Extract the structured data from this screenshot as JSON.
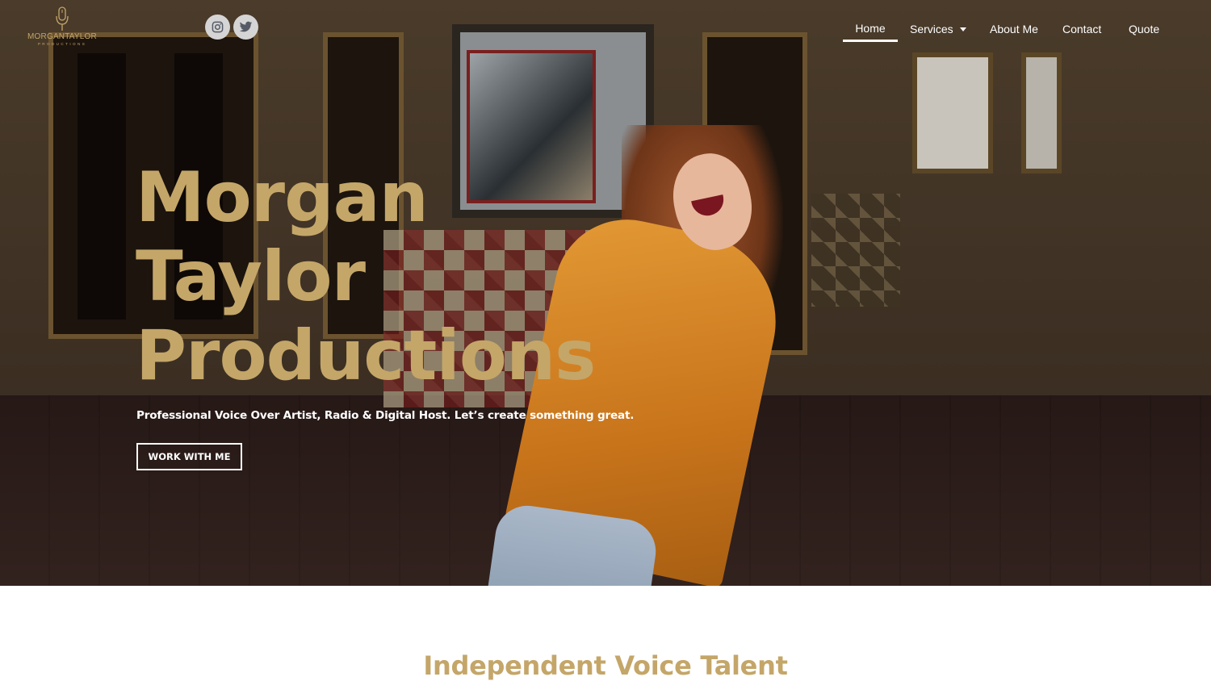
{
  "brand": {
    "logo_name": "MORGANTAYLOR",
    "logo_sub": "PRODUCTIONS",
    "logo_icon": "microphone-icon",
    "accent_color": "#c4a669"
  },
  "social": {
    "instagram_icon": "instagram-icon",
    "twitter_icon": "twitter-icon"
  },
  "nav": {
    "items": [
      {
        "label": "Home",
        "active": true
      },
      {
        "label": "Services",
        "has_dropdown": true
      },
      {
        "label": "About Me"
      },
      {
        "label": "Contact"
      },
      {
        "label": "Quote"
      }
    ]
  },
  "hero": {
    "title_lines": [
      "Morgan",
      "Taylor",
      "Productions"
    ],
    "tagline": "Professional Voice Over Artist, Radio & Digital Host. Let’s create something great.",
    "cta_label": "WORK WITH ME"
  },
  "section": {
    "title": "Independent Voice Talent"
  }
}
